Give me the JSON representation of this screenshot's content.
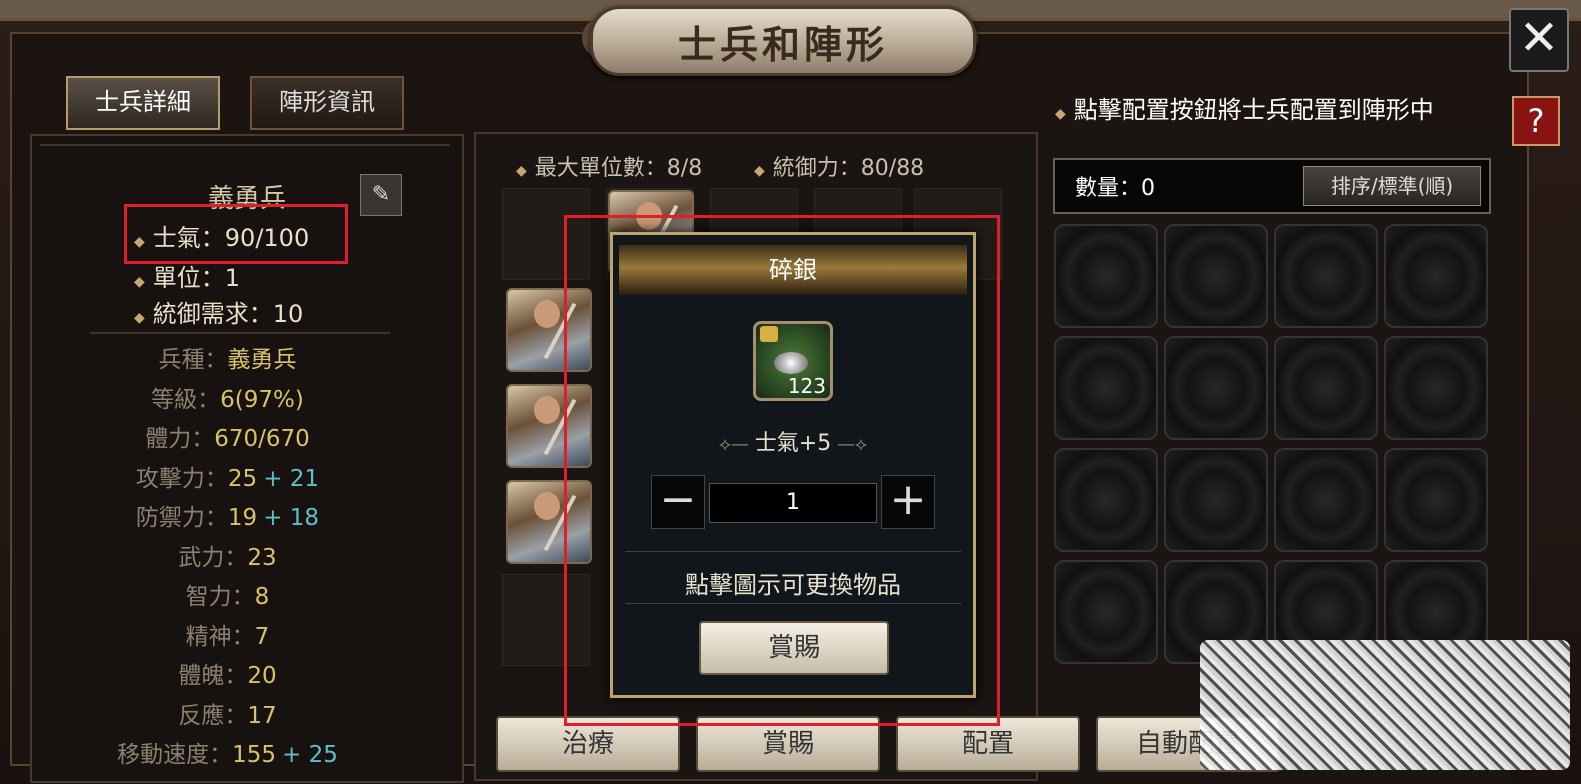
{
  "window": {
    "title": "士兵和陣形",
    "close_symbol": "✕",
    "help_symbol": "?"
  },
  "tabs": [
    {
      "label": "士兵詳細",
      "active": true
    },
    {
      "label": "陣形資訊",
      "active": false
    }
  ],
  "hint": "點擊配置按鈕將士兵配置到陣形中",
  "unit": {
    "name": "義勇兵",
    "edit_icon": "pencil-icon",
    "morale": "士氣：90/100",
    "units": "單位：1",
    "command_req": "統御需求：10"
  },
  "attributes": [
    {
      "label": "兵種：",
      "value": "義勇兵",
      "bonus": ""
    },
    {
      "label": "等級：",
      "value": "6(97%)",
      "bonus": ""
    },
    {
      "label": "體力：",
      "value": "670/670",
      "bonus": ""
    },
    {
      "label": "攻擊力：",
      "value": "25",
      "bonus": "+ 21"
    },
    {
      "label": "防禦力：",
      "value": "19",
      "bonus": "+ 18"
    },
    {
      "label": "武力：",
      "value": "23",
      "bonus": ""
    },
    {
      "label": "智力：",
      "value": "8",
      "bonus": ""
    },
    {
      "label": "精神：",
      "value": "7",
      "bonus": ""
    },
    {
      "label": "體魄：",
      "value": "20",
      "bonus": ""
    },
    {
      "label": "反應：",
      "value": "17",
      "bonus": ""
    },
    {
      "label": "移動速度：",
      "value": "155",
      "bonus": "+ 25"
    }
  ],
  "formation": {
    "max_units": "最大單位數：8/8",
    "command": "統御力：80/88"
  },
  "inventory": {
    "quantity": "數量：0",
    "sort_button": "排序/標準(順)"
  },
  "popup": {
    "title": "碎銀",
    "item_count": "123",
    "effect": "士氣+5",
    "quantity": "1",
    "minus": "−",
    "plus": "+",
    "hint": "點擊圖示可更換物品",
    "reward_button": "賞賜"
  },
  "bottom_buttons": [
    "治療",
    "賞賜",
    "配置",
    "自動配置"
  ],
  "colors": {
    "highlight": "#e11d2c",
    "value": "#d8c26a",
    "bonus": "#5fc0c8"
  }
}
